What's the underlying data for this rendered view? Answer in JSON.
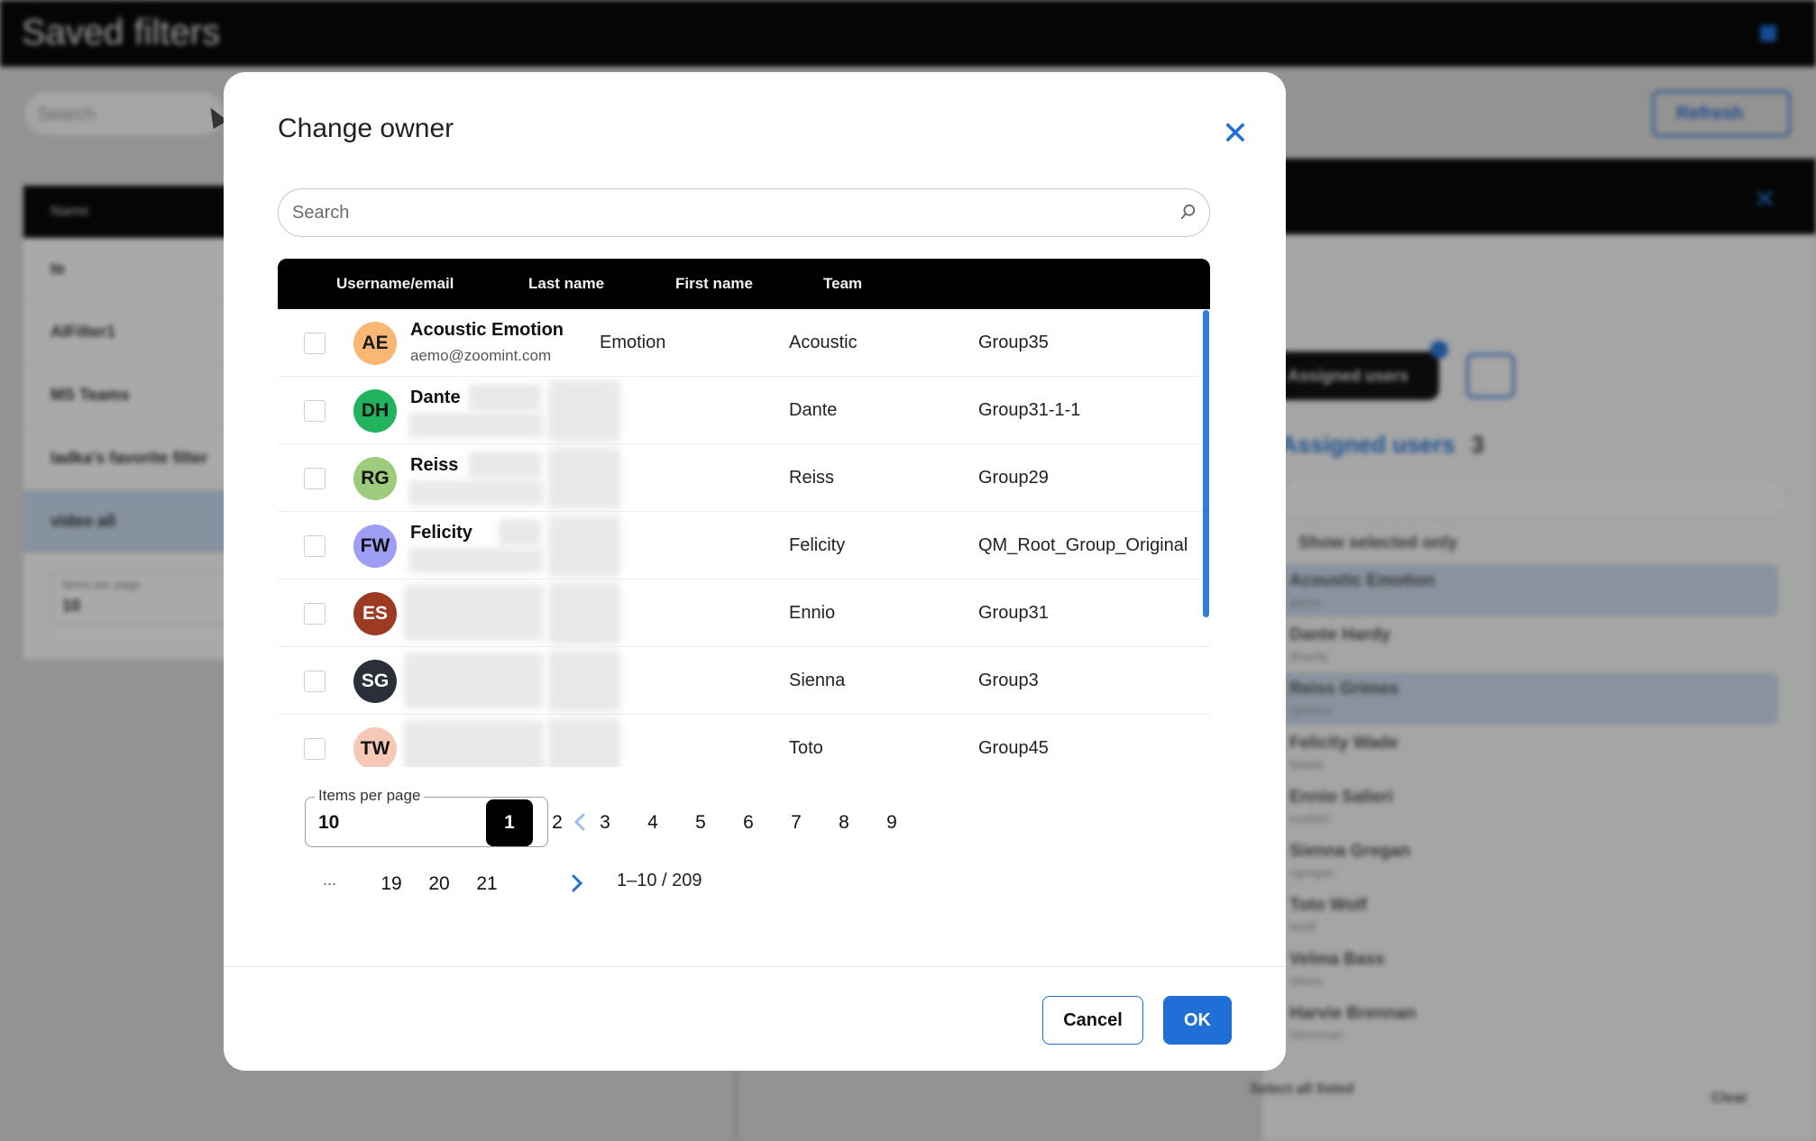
{
  "background": {
    "page_title": "Saved filters",
    "search_placeholder": "Search",
    "refresh_label": "Refresh",
    "left_list": {
      "header": "Name",
      "items": [
        "te",
        "AIFilter1",
        "MS Teams",
        "ladka's favorite filter",
        "video all"
      ],
      "items_per_page_label": "Items per page",
      "items_per_page_value": "10"
    },
    "right_panel": {
      "assigned_users_tab": "Assigned users",
      "assigned_users_heading": "Assigned users",
      "assigned_count": "3",
      "show_selected_only": "Show selected only",
      "users": [
        {
          "name": "Acoustic Emotion",
          "sub": "aemo",
          "selected": true
        },
        {
          "name": "Dante Hardy",
          "sub": "dhardy",
          "selected": false
        },
        {
          "name": "Reiss Grimes",
          "sub": "rgrimes",
          "selected": true
        },
        {
          "name": "Felicity Wade",
          "sub": "fwade",
          "selected": false
        },
        {
          "name": "Ennio Salieri",
          "sub": "esalieri",
          "selected": false
        },
        {
          "name": "Sienna Gregan",
          "sub": "sgregan",
          "selected": false
        },
        {
          "name": "Toto Wolf",
          "sub": "twolf",
          "selected": false
        },
        {
          "name": "Velma Bass",
          "sub": "vbass",
          "selected": false
        },
        {
          "name": "Harvie Brennan",
          "sub": "hbrennan",
          "selected": false
        }
      ],
      "select_all_label": "Select all listed",
      "clear_label": "Clear"
    }
  },
  "modal": {
    "title": "Change owner",
    "close_icon": "close-icon",
    "search_placeholder": "Search",
    "columns": {
      "username": "Username/email",
      "last_name": "Last name",
      "first_name": "First name",
      "team": "Team"
    },
    "rows": [
      {
        "initials": "AE",
        "avatar_color": "#f9b776",
        "avatar_text": "#1a1a1a",
        "username": "Acoustic Emotion",
        "email": "aemo@zoomint.com",
        "last_name": "Emotion",
        "first_name": "Acoustic",
        "team": "Group35"
      },
      {
        "initials": "DH",
        "avatar_color": "#22b35e",
        "avatar_text": "#111111",
        "username": "Dante",
        "email": "",
        "last_name": "",
        "first_name": "Dante",
        "team": "Group31-1-1"
      },
      {
        "initials": "RG",
        "avatar_color": "#9ccc7c",
        "avatar_text": "#111111",
        "username": "Reiss",
        "email": "",
        "last_name": "",
        "first_name": "Reiss",
        "team": "Group29"
      },
      {
        "initials": "FW",
        "avatar_color": "#9e9ef5",
        "avatar_text": "#111111",
        "username": "Felicity",
        "email": "",
        "last_name": "",
        "first_name": "Felicity",
        "team": "QM_Root_Group_Original"
      },
      {
        "initials": "ES",
        "avatar_color": "#9c3a24",
        "avatar_text": "#ffffff",
        "username": "",
        "email": "",
        "last_name": "",
        "first_name": "Ennio",
        "team": "Group31"
      },
      {
        "initials": "SG",
        "avatar_color": "#2a2f3a",
        "avatar_text": "#ffffff",
        "username": "",
        "email": "",
        "last_name": "",
        "first_name": "Sienna",
        "team": "Group3"
      },
      {
        "initials": "TW",
        "avatar_color": "#f6c9b6",
        "avatar_text": "#111111",
        "username": "",
        "email": "",
        "last_name": "",
        "first_name": "Toto",
        "team": "Group45"
      }
    ],
    "items_per_page_label": "Items per page",
    "items_per_page_value": "10",
    "pages": [
      "1",
      "2",
      "3",
      "4",
      "5",
      "6",
      "7",
      "8",
      "9"
    ],
    "current_page": "1",
    "ellipsis": "...",
    "tail_pages": [
      "19",
      "20",
      "21"
    ],
    "range_text": "1–10 / 209",
    "cancel_label": "Cancel",
    "ok_label": "OK",
    "accent_color": "#1f6fd6"
  }
}
